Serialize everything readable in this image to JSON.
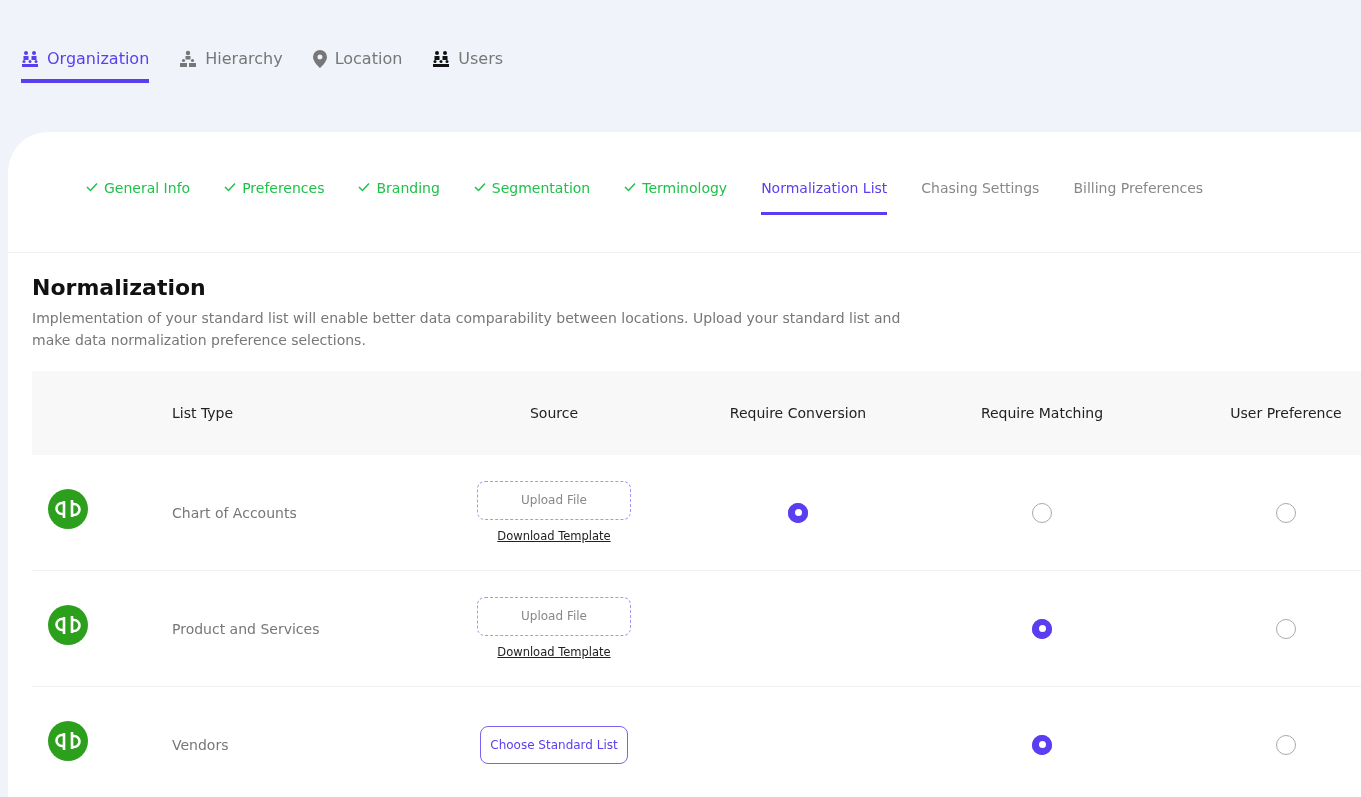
{
  "top_tabs": [
    {
      "label": "Organization",
      "selected": true
    },
    {
      "label": "Hierarchy",
      "selected": false
    },
    {
      "label": "Location",
      "selected": false
    },
    {
      "label": "Users",
      "selected": false
    }
  ],
  "sub_tabs": [
    {
      "label": "General Info",
      "completed": true,
      "selected": false
    },
    {
      "label": "Preferences",
      "completed": true,
      "selected": false
    },
    {
      "label": "Branding",
      "completed": true,
      "selected": false
    },
    {
      "label": "Segmentation",
      "completed": true,
      "selected": false
    },
    {
      "label": "Terminology",
      "completed": true,
      "selected": false
    },
    {
      "label": "Normalization List",
      "completed": false,
      "selected": true
    },
    {
      "label": "Chasing Settings",
      "completed": false,
      "selected": false
    },
    {
      "label": "Billing Preferences",
      "completed": false,
      "selected": false
    }
  ],
  "section": {
    "title": "Normalization",
    "description": "Implementation of your standard list will enable better data comparability between locations. Upload your standard list and make data normalization preference selections."
  },
  "table": {
    "columns": [
      "List Type",
      "Source",
      "Require Conversion",
      "Require Matching",
      "User Preference"
    ],
    "rows": [
      {
        "list_type": "Chart of Accounts",
        "source": {
          "kind": "upload",
          "button": "Upload File",
          "link": "Download Template"
        },
        "require_conversion": {
          "selected": true
        },
        "require_matching": {
          "selected": false
        },
        "user_preference": {
          "selected": false
        }
      },
      {
        "list_type": "Product and Services",
        "source": {
          "kind": "upload",
          "button": "Upload File",
          "link": "Download Template"
        },
        "require_matching": {
          "selected": true
        },
        "user_preference": {
          "selected": false
        }
      },
      {
        "list_type": "Vendors",
        "source": {
          "kind": "choose",
          "button": "Choose Standard List"
        },
        "require_matching": {
          "selected": true
        },
        "user_preference": {
          "selected": false
        }
      }
    ]
  }
}
